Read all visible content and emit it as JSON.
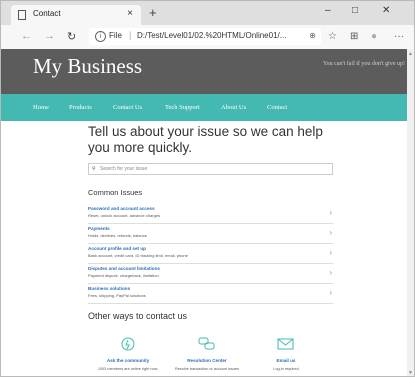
{
  "browser": {
    "tab_title": "Contact",
    "tab_close": "×",
    "new_tab": "+",
    "controls": {
      "minimize": "–",
      "maximize": "□",
      "close": "✕"
    },
    "nav": {
      "back": "←",
      "forward": "→",
      "refresh": "↻"
    },
    "address": {
      "scheme_label": "File",
      "separator": "|",
      "url": "D:/Test/Level01/02.%20HTML/Online01/...",
      "zoom_icon": "⊕"
    },
    "toolbar_icons": {
      "favorite": "☆",
      "collections": "⊞",
      "profile": "●",
      "more": "···"
    }
  },
  "site": {
    "brand": "My Business",
    "tagline": "You can't fail if you don't give up!",
    "menu": [
      "Home",
      "Products",
      "Contact Us",
      "Tech Support",
      "About Us",
      "Contact"
    ]
  },
  "main": {
    "headline": "Tell us about your issue so we can help you more quickly.",
    "search_placeholder": "Search for your issue",
    "common_title": "Common Issues",
    "issues": [
      {
        "title": "Password and account access",
        "sub": "Reset, unlock account, advance charges"
      },
      {
        "title": "Payments",
        "sub": "Holds, declines, refunds, balance"
      },
      {
        "title": "Account profile and set up",
        "sub": "Bank account, credit card, ID tracking limit, email, phone"
      },
      {
        "title": "Disputes and account limitations",
        "sub": "Payment dispute, chargeback, limitation"
      },
      {
        "title": "Business solutions",
        "sub": "Fees, shipping, PayPal solutions"
      }
    ],
    "other_title": "Other ways to contact us",
    "cards": [
      {
        "label": "Ask the community",
        "sub": "1003 members are online right now."
      },
      {
        "label": "Resolution Center",
        "sub": "Resolve transaction or account issues"
      },
      {
        "label": "Email us",
        "sub": "Log-in required"
      }
    ]
  },
  "colors": {
    "banner": "#5c5c5c",
    "menu": "#44b9b2",
    "link": "#2a6ebb"
  }
}
